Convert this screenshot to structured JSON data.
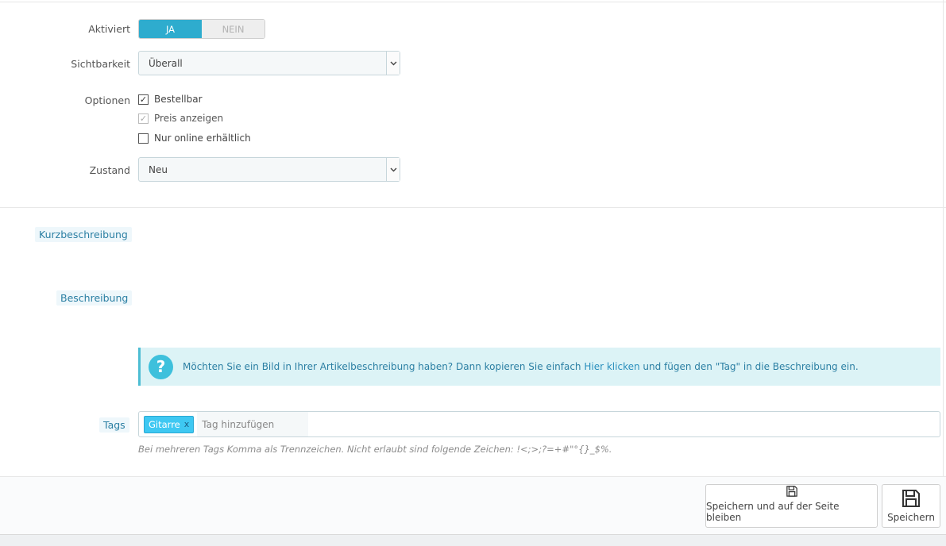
{
  "form": {
    "aktiviert_label": "Aktiviert",
    "toggle_yes": "JA",
    "toggle_no": "NEIN",
    "toggle_value": "JA",
    "sichtbarkeit_label": "Sichtbarkeit",
    "sichtbarkeit_value": "Überall",
    "optionen_label": "Optionen",
    "options": [
      {
        "label": "Bestellbar",
        "checked": true,
        "disabled": false
      },
      {
        "label": "Preis anzeigen",
        "checked": true,
        "disabled": true
      },
      {
        "label": "Nur online erhältlich",
        "checked": false,
        "disabled": false
      }
    ],
    "zustand_label": "Zustand",
    "zustand_value": "Neu",
    "kurzbeschreibung_label": "Kurzbeschreibung",
    "beschreibung_label": "Beschreibung"
  },
  "info": {
    "text_before": "Möchten Sie ein Bild in Ihrer Artikelbeschreibung haben? Dann kopieren Sie einfach ",
    "link": "Hier klicken",
    "text_after": " und fügen den \"Tag\" in die Beschreibung ein."
  },
  "tags": {
    "label": "Tags",
    "items": [
      "Gitarre"
    ],
    "remove_glyph": "x",
    "placeholder": "Tag hinzufügen",
    "help": "Bei mehreren Tags Komma als Trennzeichen. Nicht erlaubt sind folgende Zeichen: !<;>;?=+#\"°{}_$%."
  },
  "footer": {
    "save_stay": "Speichern und auf der Seite bleiben",
    "save": "Speichern",
    "icon": "floppy-disk-icon"
  },
  "colors": {
    "accent": "#2eacce",
    "info_bg": "#dcf3f6",
    "tag_chip": "#3ec8f2"
  }
}
